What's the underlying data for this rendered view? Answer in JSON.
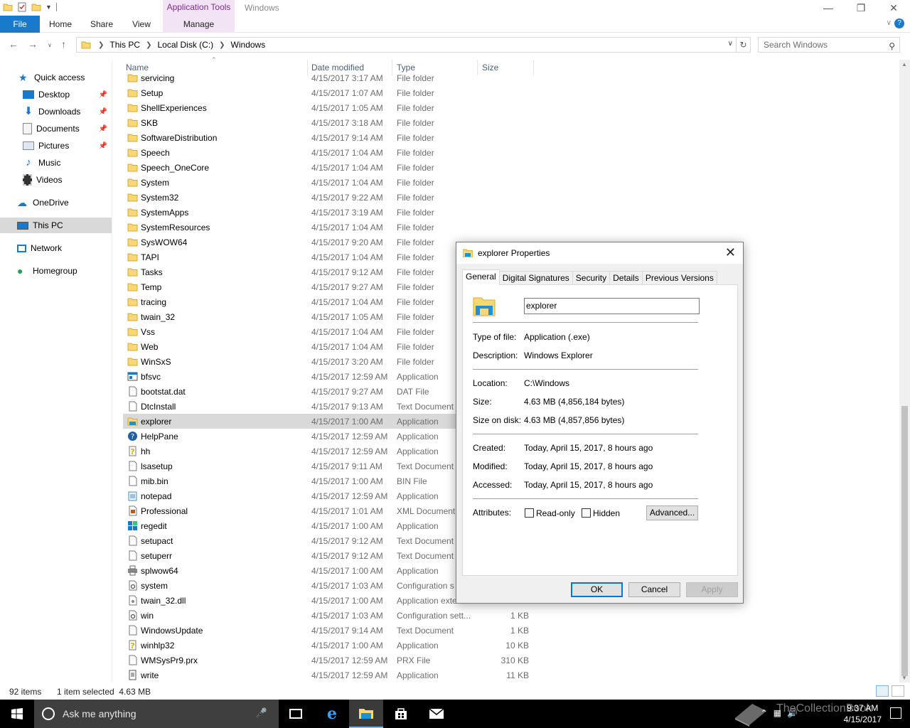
{
  "window": {
    "context_tab": "Application Tools",
    "title": "Windows"
  },
  "ribbon": {
    "tabs": [
      "File",
      "Home",
      "Share",
      "View",
      "Manage"
    ]
  },
  "address": {
    "crumbs": [
      "This PC",
      "Local Disk (C:)",
      "Windows"
    ],
    "search_placeholder": "Search Windows"
  },
  "nav": {
    "items": [
      {
        "label": "Quick access",
        "icon": "star-icon"
      },
      {
        "label": "Desktop",
        "icon": "desktop-icon",
        "pinned": true
      },
      {
        "label": "Downloads",
        "icon": "download-icon",
        "pinned": true
      },
      {
        "label": "Documents",
        "icon": "documents-icon",
        "pinned": true
      },
      {
        "label": "Pictures",
        "icon": "pictures-icon",
        "pinned": true
      },
      {
        "label": "Music",
        "icon": "music-icon"
      },
      {
        "label": "Videos",
        "icon": "videos-icon"
      },
      {
        "label": "OneDrive",
        "icon": "cloud-icon"
      },
      {
        "label": "This PC",
        "icon": "pc-icon",
        "selected": true
      },
      {
        "label": "Network",
        "icon": "network-icon"
      },
      {
        "label": "Homegroup",
        "icon": "homegroup-icon"
      }
    ]
  },
  "columns": {
    "name": "Name",
    "date": "Date modified",
    "type": "Type",
    "size": "Size"
  },
  "files": [
    {
      "name": "servicing",
      "date": "4/15/2017 3:17 AM",
      "type": "File folder",
      "size": "",
      "icon": "folder"
    },
    {
      "name": "Setup",
      "date": "4/15/2017 1:07 AM",
      "type": "File folder",
      "size": "",
      "icon": "folder"
    },
    {
      "name": "ShellExperiences",
      "date": "4/15/2017 1:05 AM",
      "type": "File folder",
      "size": "",
      "icon": "folder"
    },
    {
      "name": "SKB",
      "date": "4/15/2017 3:18 AM",
      "type": "File folder",
      "size": "",
      "icon": "folder"
    },
    {
      "name": "SoftwareDistribution",
      "date": "4/15/2017 9:14 AM",
      "type": "File folder",
      "size": "",
      "icon": "folder"
    },
    {
      "name": "Speech",
      "date": "4/15/2017 1:04 AM",
      "type": "File folder",
      "size": "",
      "icon": "folder"
    },
    {
      "name": "Speech_OneCore",
      "date": "4/15/2017 1:04 AM",
      "type": "File folder",
      "size": "",
      "icon": "folder"
    },
    {
      "name": "System",
      "date": "4/15/2017 1:04 AM",
      "type": "File folder",
      "size": "",
      "icon": "folder"
    },
    {
      "name": "System32",
      "date": "4/15/2017 9:22 AM",
      "type": "File folder",
      "size": "",
      "icon": "folder"
    },
    {
      "name": "SystemApps",
      "date": "4/15/2017 3:19 AM",
      "type": "File folder",
      "size": "",
      "icon": "folder"
    },
    {
      "name": "SystemResources",
      "date": "4/15/2017 1:04 AM",
      "type": "File folder",
      "size": "",
      "icon": "folder"
    },
    {
      "name": "SysWOW64",
      "date": "4/15/2017 9:20 AM",
      "type": "File folder",
      "size": "",
      "icon": "folder"
    },
    {
      "name": "TAPI",
      "date": "4/15/2017 1:04 AM",
      "type": "File folder",
      "size": "",
      "icon": "folder"
    },
    {
      "name": "Tasks",
      "date": "4/15/2017 9:12 AM",
      "type": "File folder",
      "size": "",
      "icon": "folder"
    },
    {
      "name": "Temp",
      "date": "4/15/2017 9:27 AM",
      "type": "File folder",
      "size": "",
      "icon": "folder"
    },
    {
      "name": "tracing",
      "date": "4/15/2017 1:04 AM",
      "type": "File folder",
      "size": "",
      "icon": "folder"
    },
    {
      "name": "twain_32",
      "date": "4/15/2017 1:05 AM",
      "type": "File folder",
      "size": "",
      "icon": "folder"
    },
    {
      "name": "Vss",
      "date": "4/15/2017 1:04 AM",
      "type": "File folder",
      "size": "",
      "icon": "folder"
    },
    {
      "name": "Web",
      "date": "4/15/2017 1:04 AM",
      "type": "File folder",
      "size": "",
      "icon": "folder"
    },
    {
      "name": "WinSxS",
      "date": "4/15/2017 3:20 AM",
      "type": "File folder",
      "size": "",
      "icon": "folder"
    },
    {
      "name": "bfsvc",
      "date": "4/15/2017 12:59 AM",
      "type": "Application",
      "size": "",
      "icon": "app"
    },
    {
      "name": "bootstat.dat",
      "date": "4/15/2017 9:27 AM",
      "type": "DAT File",
      "size": "",
      "icon": "doc"
    },
    {
      "name": "DtcInstall",
      "date": "4/15/2017 9:13 AM",
      "type": "Text Document",
      "size": "",
      "icon": "doc"
    },
    {
      "name": "explorer",
      "date": "4/15/2017 1:00 AM",
      "type": "Application",
      "size": "",
      "icon": "explorer",
      "selected": true
    },
    {
      "name": "HelpPane",
      "date": "4/15/2017 12:59 AM",
      "type": "Application",
      "size": "",
      "icon": "help"
    },
    {
      "name": "hh",
      "date": "4/15/2017 12:59 AM",
      "type": "Application",
      "size": "",
      "icon": "hh"
    },
    {
      "name": "lsasetup",
      "date": "4/15/2017 9:11 AM",
      "type": "Text Document",
      "size": "",
      "icon": "doc"
    },
    {
      "name": "mib.bin",
      "date": "4/15/2017 1:00 AM",
      "type": "BIN File",
      "size": "",
      "icon": "doc"
    },
    {
      "name": "notepad",
      "date": "4/15/2017 12:59 AM",
      "type": "Application",
      "size": "",
      "icon": "notepad"
    },
    {
      "name": "Professional",
      "date": "4/15/2017 1:01 AM",
      "type": "XML Document",
      "size": "",
      "icon": "xml"
    },
    {
      "name": "regedit",
      "date": "4/15/2017 1:00 AM",
      "type": "Application",
      "size": "",
      "icon": "regedit"
    },
    {
      "name": "setupact",
      "date": "4/15/2017 9:12 AM",
      "type": "Text Document",
      "size": "",
      "icon": "doc"
    },
    {
      "name": "setuperr",
      "date": "4/15/2017 9:12 AM",
      "type": "Text Document",
      "size": "",
      "icon": "doc"
    },
    {
      "name": "splwow64",
      "date": "4/15/2017 1:00 AM",
      "type": "Application",
      "size": "",
      "icon": "printer"
    },
    {
      "name": "system",
      "date": "4/15/2017 1:03 AM",
      "type": "Configuration s",
      "size": "",
      "icon": "config"
    },
    {
      "name": "twain_32.dll",
      "date": "4/15/2017 1:00 AM",
      "type": "Application exte",
      "size": "",
      "icon": "dll"
    },
    {
      "name": "win",
      "date": "4/15/2017 1:03 AM",
      "type": "Configuration sett...",
      "size": "1 KB",
      "icon": "config"
    },
    {
      "name": "WindowsUpdate",
      "date": "4/15/2017 9:14 AM",
      "type": "Text Document",
      "size": "1 KB",
      "icon": "doc"
    },
    {
      "name": "winhlp32",
      "date": "4/15/2017 1:00 AM",
      "type": "Application",
      "size": "10 KB",
      "icon": "hh"
    },
    {
      "name": "WMSysPr9.prx",
      "date": "4/15/2017 12:59 AM",
      "type": "PRX File",
      "size": "310 KB",
      "icon": "doc"
    },
    {
      "name": "write",
      "date": "4/15/2017 12:59 AM",
      "type": "Application",
      "size": "11 KB",
      "icon": "write"
    }
  ],
  "status": {
    "count": "92 items",
    "selection": "1 item selected  4.63 MB"
  },
  "dialog": {
    "title": "explorer Properties",
    "tabs": [
      "General",
      "Digital Signatures",
      "Security",
      "Details",
      "Previous Versions"
    ],
    "active_tab": "General",
    "file_name": "explorer",
    "labels": {
      "type": "Type of file:",
      "description": "Description:",
      "location": "Location:",
      "size": "Size:",
      "size_on_disk": "Size on disk:",
      "created": "Created:",
      "modified": "Modified:",
      "accessed": "Accessed:",
      "attributes": "Attributes:"
    },
    "values": {
      "type": "Application (.exe)",
      "description": "Windows Explorer",
      "location": "C:\\Windows",
      "size": "4.63 MB (4,856,184 bytes)",
      "size_on_disk": "4.63 MB (4,857,856 bytes)",
      "created": "Today, April 15, 2017, 8 hours ago",
      "modified": "Today, April 15, 2017, 8 hours ago",
      "accessed": "Today, April 15, 2017, 8 hours ago"
    },
    "attributes": {
      "readonly": "Read-only",
      "hidden": "Hidden",
      "advanced": "Advanced..."
    },
    "buttons": {
      "ok": "OK",
      "cancel": "Cancel",
      "apply": "Apply"
    }
  },
  "taskbar": {
    "search_placeholder": "Ask me anything",
    "time": "9:37 AM",
    "date": "4/15/2017",
    "watermark": "TheCollectionBook"
  },
  "colors": {
    "accent": "#1979ca",
    "selection": "#d9d9d9",
    "folder": "#f8d775",
    "taskbar": "#000000"
  }
}
